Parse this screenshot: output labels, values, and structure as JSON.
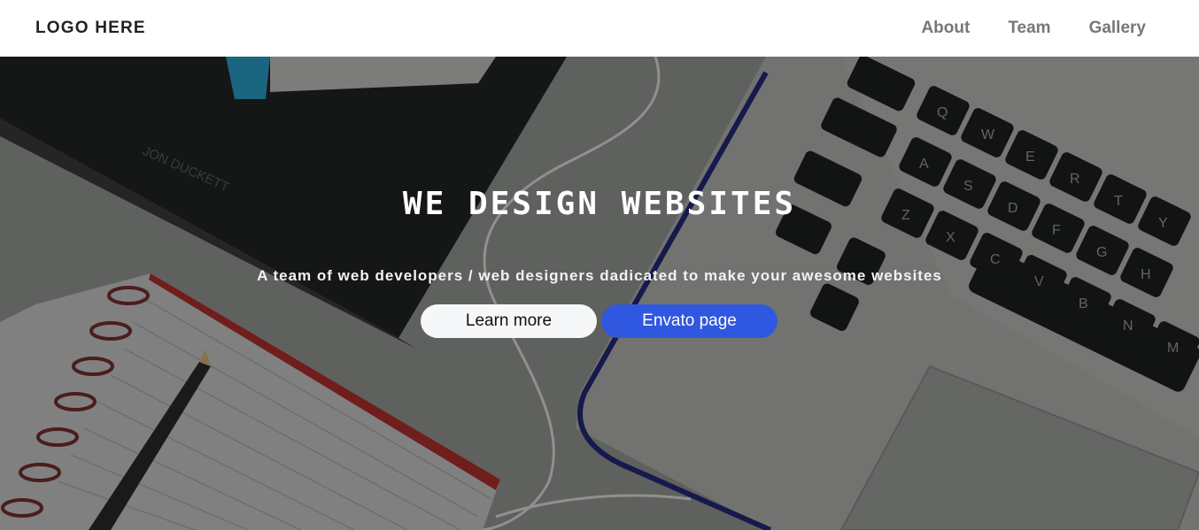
{
  "navbar": {
    "logo": "LOGO HERE",
    "links": [
      {
        "label": "About"
      },
      {
        "label": "Team"
      },
      {
        "label": "Gallery"
      }
    ]
  },
  "hero": {
    "title": "WE DESIGN WEBSITES",
    "subtitle": "A team of web developers / web designers dadicated to make your awesome websites",
    "book_text": "JON DUCKETT",
    "buttons": {
      "learn_more": "Learn more",
      "envato": "Envato page"
    }
  },
  "keyboard": {
    "row1": [
      "Q",
      "W",
      "E",
      "R",
      "T",
      "Y"
    ],
    "row2": [
      "A",
      "S",
      "D",
      "F",
      "G",
      "H"
    ],
    "row3": [
      "Z",
      "X",
      "C",
      "V",
      "B",
      "N",
      "M"
    ]
  },
  "colors": {
    "primary_button": "#3057e0",
    "light_button": "#f6f7f9",
    "nav_text": "#777777"
  }
}
